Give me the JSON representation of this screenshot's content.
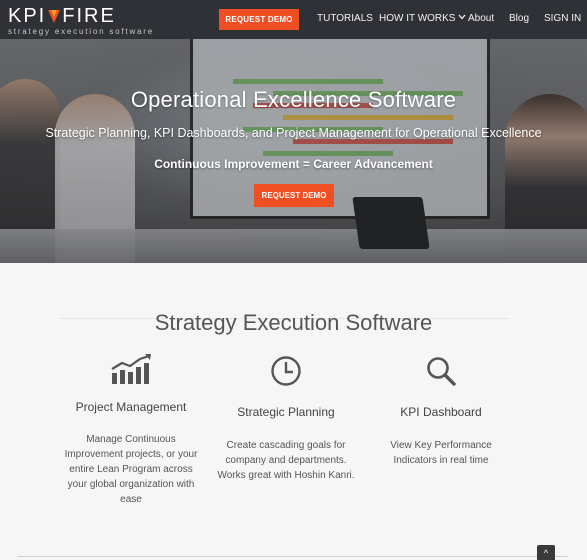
{
  "brand": {
    "logo_left": "KPI",
    "logo_right": "FIRE",
    "tagline": "strategy  execution  software",
    "accent_color": "#f04e23",
    "nav_bg": "#2f3136"
  },
  "nav": {
    "demo_button": "REQUEST DEMO",
    "items": [
      {
        "label": "TUTORIALS"
      },
      {
        "label": "HOW IT WORKS"
      },
      {
        "label": "About"
      },
      {
        "label": "Blog"
      },
      {
        "label": "SIGN IN"
      }
    ],
    "dropdown_icon": "chevron-down-icon"
  },
  "hero": {
    "title": "Operational Excellence Software",
    "subtitle": "Strategic Planning, KPI Dashboards, and Project Management for Operational Excellence",
    "tagline": "Continuous Improvement = Career Advancement",
    "cta": "REQUEST DEMO"
  },
  "section": {
    "title": "Strategy Execution Software",
    "features": [
      {
        "icon": "bar-chart-trend-icon",
        "title": "Project Management",
        "desc_lines": [
          "Manage Continuous",
          "Improvement projects, or your",
          "entire Lean Program across",
          "your global organization with",
          "ease"
        ]
      },
      {
        "icon": "clock-icon",
        "title": "Strategic Planning",
        "desc_lines": [
          "Create cascading goals for",
          "company and departments.",
          "Works great with Hoshin Kanri."
        ]
      },
      {
        "icon": "search-icon",
        "title": "KPI Dashboard",
        "desc_lines": [
          "View Key Performance",
          "Indicators in real time"
        ]
      }
    ]
  },
  "scroll_top": {
    "icon": "chevron-up-icon",
    "glyph": "^"
  }
}
